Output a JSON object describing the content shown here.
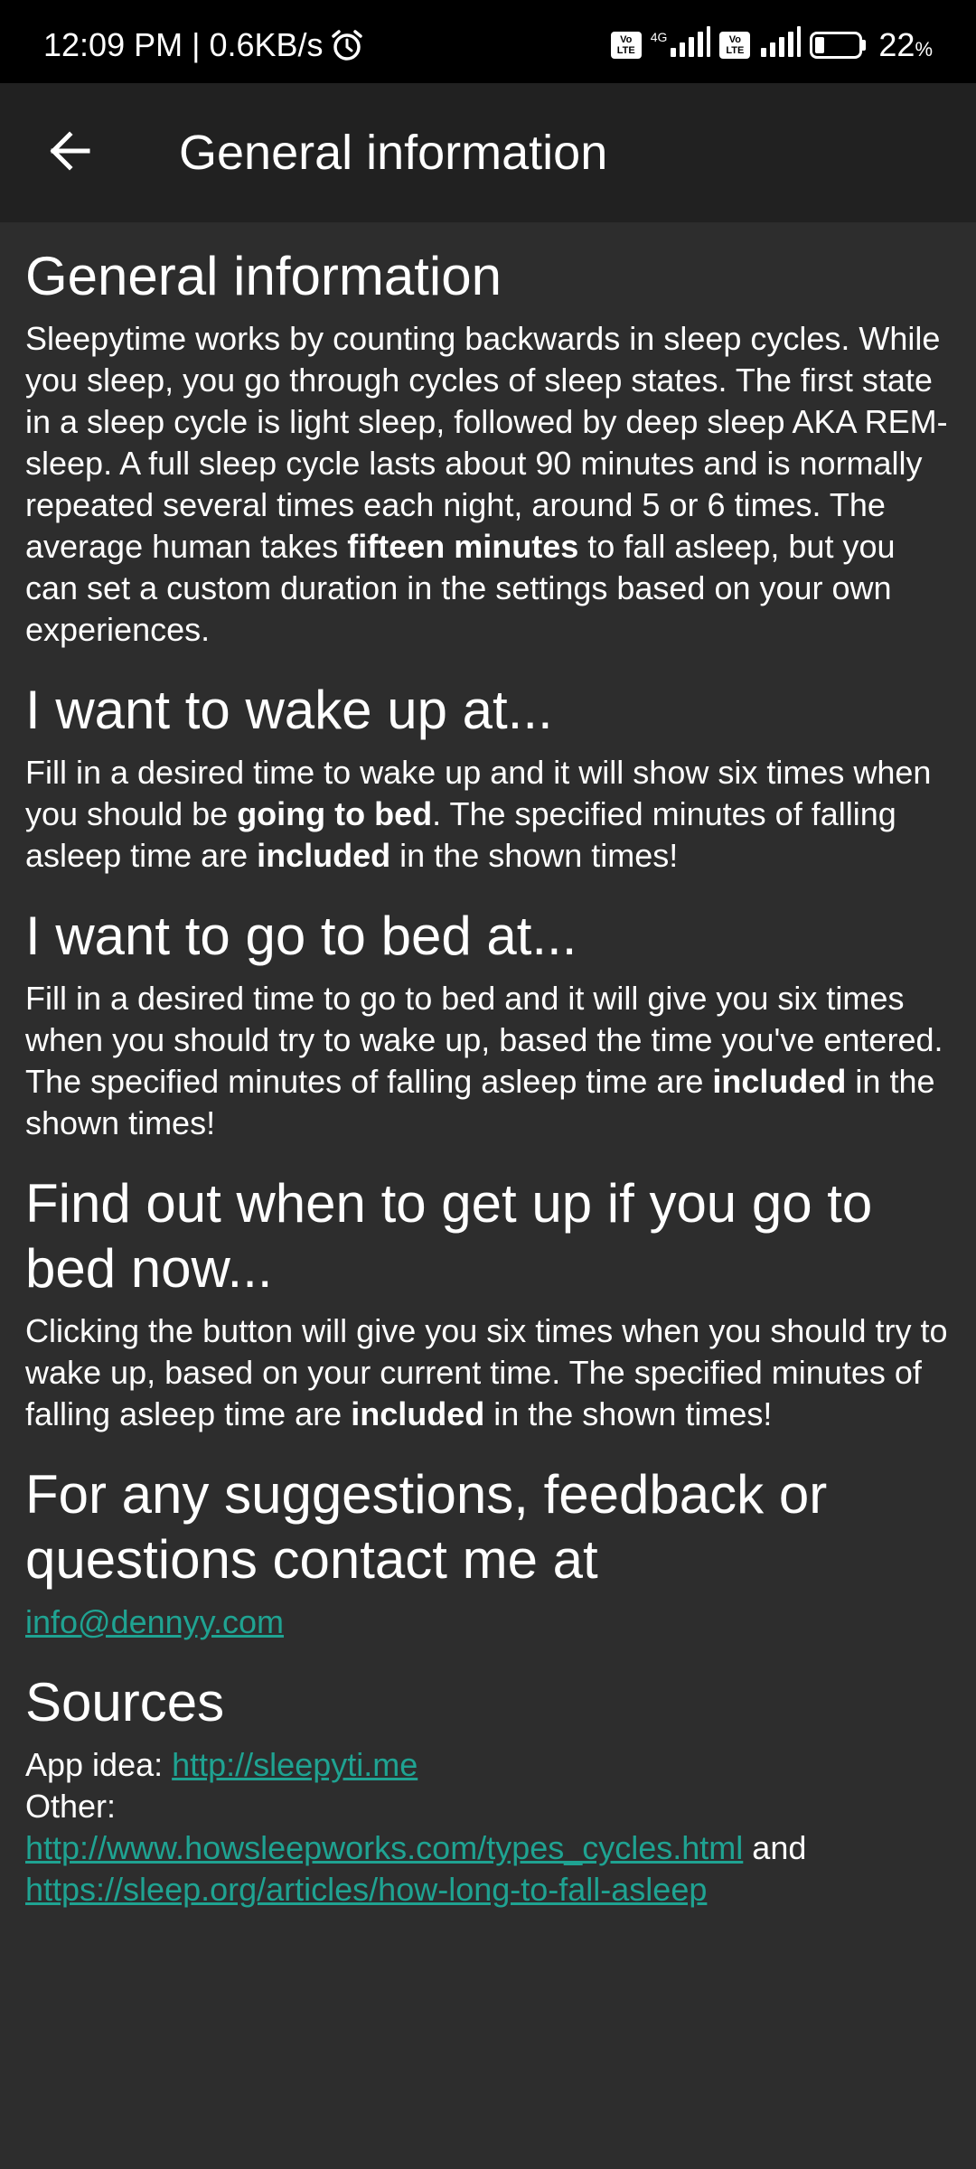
{
  "status_bar": {
    "time": "12:09 PM",
    "separator": "|",
    "speed": "0.6KB/s",
    "network_type": "4G",
    "volte_label_1": "Vo\nLTE",
    "battery_percent": "22",
    "battery_unit": "%",
    "battery_level": 0.22,
    "icons": [
      "alarm-icon",
      "volte-icon",
      "signal-icon",
      "volte-icon",
      "signal-icon",
      "battery-icon"
    ]
  },
  "app_bar": {
    "title": "General information",
    "back_icon": "arrow-left-icon"
  },
  "sections": {
    "general": {
      "title": "General information",
      "p1": "Sleepytime works by counting backwards in sleep cycles. While you sleep, you go through cycles of sleep states. The first state in a sleep cycle is light sleep, followed by deep sleep AKA REM-sleep. A full sleep cycle lasts about 90 minutes and is normally repeated several times each night, around 5 or 6 times. The average human takes ",
      "bold": "fifteen minutes",
      "p2": " to fall asleep, but you can set a custom duration in the settings based on your own experiences."
    },
    "wake_up": {
      "title": "I want to wake up at...",
      "p1": "Fill in a desired time to wake up and it will show six times when you should be ",
      "bold1": "going to bed",
      "p2": ". The specified minutes of falling asleep time are ",
      "bold2": "included",
      "p3": " in the shown times!"
    },
    "go_to_bed": {
      "title": "I want to go to bed at...",
      "p1": "Fill in a desired time to go to bed and it will give you six times when you should try to wake up, based the time you've entered. The specified minutes of falling asleep time are ",
      "bold": "included",
      "p2": " in the shown times!"
    },
    "bed_now": {
      "title": "Find out when to get up if you go to bed now...",
      "p1": "Clicking the button will give you six times when you should try to wake up, based on your current time. The specified minutes of falling asleep time are ",
      "bold": "included",
      "p2": " in the shown times!"
    },
    "contact": {
      "title": "For any suggestions, feedback or questions contact me at",
      "email": "info@dennyy.com"
    },
    "sources": {
      "title": "Sources",
      "app_idea_label": "App idea: ",
      "app_idea_link": "http://sleepyti.me",
      "other_label": "Other:",
      "link1": "http://www.howsleepworks.com/types_cycles.html",
      "and": " and",
      "link2": "https://sleep.org/articles/how-long-to-fall-asleep"
    }
  },
  "colors": {
    "background": "#2d2d2d",
    "app_bar": "#212121",
    "status_bar": "#000000",
    "link": "#1fa392",
    "text": "#ffffff"
  }
}
